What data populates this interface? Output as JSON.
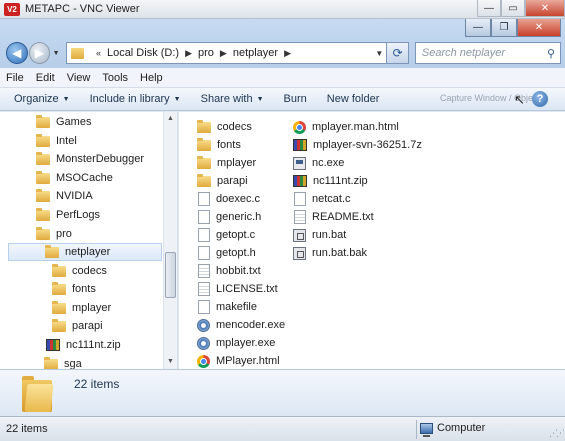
{
  "vnc": {
    "logo": "V2",
    "title": "METAPC - VNC Viewer",
    "minimize": "—",
    "maximize": "▭",
    "close": "✕"
  },
  "window": {
    "minimize": "—",
    "maximize": "❐",
    "close": "✕"
  },
  "address": {
    "crumbs": [
      "Local Disk (D:)",
      "pro",
      "netplayer"
    ],
    "search_placeholder": "Search netplayer"
  },
  "menu": [
    "File",
    "Edit",
    "View",
    "Tools",
    "Help"
  ],
  "commands": {
    "organize": "Organize",
    "include": "Include in library",
    "share": "Share with",
    "burn": "Burn",
    "new_folder": "New folder",
    "capture": "Capture Window / Object",
    "help_glyph": "?"
  },
  "nav_tree": [
    {
      "label": "Games",
      "icon": "folder-icon"
    },
    {
      "label": "Intel",
      "icon": "folder-icon"
    },
    {
      "label": "MonsterDebugger",
      "icon": "folder-icon"
    },
    {
      "label": "MSOCache",
      "icon": "folder-icon"
    },
    {
      "label": "NVIDIA",
      "icon": "folder-icon"
    },
    {
      "label": "PerfLogs",
      "icon": "folder-icon"
    },
    {
      "label": "pro",
      "icon": "folder-icon"
    },
    {
      "label": "netplayer",
      "icon": "folder-icon",
      "selected": true
    },
    {
      "label": "codecs",
      "icon": "folder-icon"
    },
    {
      "label": "fonts",
      "icon": "folder-icon"
    },
    {
      "label": "mplayer",
      "icon": "folder-icon"
    },
    {
      "label": "parapi",
      "icon": "folder-icon"
    },
    {
      "label": "nc111nt.zip",
      "icon": "zip-icon"
    },
    {
      "label": "sga",
      "icon": "folder-icon"
    }
  ],
  "files_col1": [
    {
      "name": "codecs",
      "icon": "folder-icon"
    },
    {
      "name": "fonts",
      "icon": "folder-icon"
    },
    {
      "name": "mplayer",
      "icon": "folder-icon"
    },
    {
      "name": "parapi",
      "icon": "folder-icon"
    },
    {
      "name": "doexec.c",
      "icon": "file-icon"
    },
    {
      "name": "generic.h",
      "icon": "file-icon"
    },
    {
      "name": "getopt.c",
      "icon": "file-icon"
    },
    {
      "name": "getopt.h",
      "icon": "file-icon"
    },
    {
      "name": "hobbit.txt",
      "icon": "text-file-icon"
    },
    {
      "name": "LICENSE.txt",
      "icon": "text-file-icon"
    },
    {
      "name": "makefile",
      "icon": "file-icon"
    },
    {
      "name": "mencoder.exe",
      "icon": "gear-icon"
    },
    {
      "name": "mplayer.exe",
      "icon": "gear-icon"
    },
    {
      "name": "MPlayer.html",
      "icon": "chrome-icon"
    }
  ],
  "files_col2": [
    {
      "name": "mplayer.man.html",
      "icon": "chrome-icon"
    },
    {
      "name": "mplayer-svn-36251.7z",
      "icon": "zip-icon"
    },
    {
      "name": "nc.exe",
      "icon": "exe-icon"
    },
    {
      "name": "nc111nt.zip",
      "icon": "zip-icon"
    },
    {
      "name": "netcat.c",
      "icon": "file-icon"
    },
    {
      "name": "README.txt",
      "icon": "text-file-icon"
    },
    {
      "name": "run.bat",
      "icon": "batch-icon"
    },
    {
      "name": "run.bat.bak",
      "icon": "batch-icon"
    }
  ],
  "details": {
    "count": "22 items"
  },
  "status": {
    "count": "22 items",
    "location": "Computer"
  }
}
